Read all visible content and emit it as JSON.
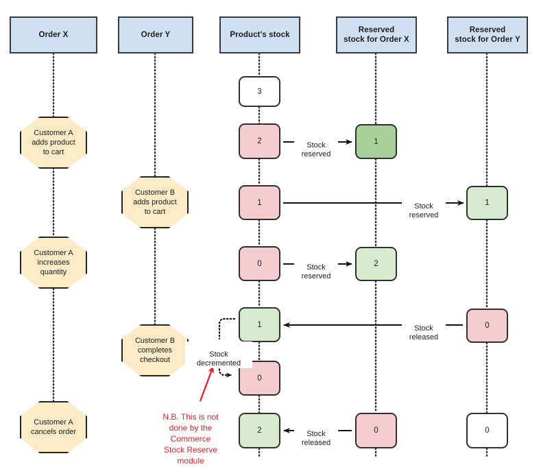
{
  "diagram": {
    "title": "Commerce Stock Reserve sequence diagram",
    "colors": {
      "header_fill": "#cfe0f3",
      "event_fill": "#fdebc8",
      "pink_fill": "#f4cdd1",
      "green_fill": "#d8ead0",
      "green_dark_fill": "#a7d09a",
      "white_fill": "#ffffff",
      "stroke": "#2f2f2f",
      "note_red": "#e8202a"
    },
    "lanes": [
      {
        "id": "order-x",
        "label": "Order X"
      },
      {
        "id": "order-y",
        "label": "Order Y"
      },
      {
        "id": "stock",
        "label": "Product's stock"
      },
      {
        "id": "reserved-x",
        "label": "Reserved\nstock for Order X"
      },
      {
        "id": "reserved-y",
        "label": "Reserved\nstock for Order Y"
      }
    ],
    "events": [
      {
        "id": "customer-a-adds",
        "lane": "order-x",
        "label": "Customer A\nadds product\nto cart"
      },
      {
        "id": "customer-a-increases",
        "lane": "order-x",
        "label": "Customer A\nincreases\nquantity"
      },
      {
        "id": "customer-a-cancels",
        "lane": "order-x",
        "label": "Customer A\ncancels order"
      },
      {
        "id": "customer-b-adds",
        "lane": "order-y",
        "label": "Customer B\nadds product\nto cart"
      },
      {
        "id": "customer-b-checkout",
        "lane": "order-y",
        "label": "Customer B\ncompletes\ncheckout"
      }
    ],
    "states": {
      "stock": [
        {
          "id": "stock-3",
          "value": "3",
          "fill": "white"
        },
        {
          "id": "stock-2",
          "value": "2",
          "fill": "pink"
        },
        {
          "id": "stock-1",
          "value": "1",
          "fill": "pink"
        },
        {
          "id": "stock-0a",
          "value": "0",
          "fill": "pink"
        },
        {
          "id": "stock-1b",
          "value": "1",
          "fill": "green"
        },
        {
          "id": "stock-0b",
          "value": "0",
          "fill": "pink"
        },
        {
          "id": "stock-2b",
          "value": "2",
          "fill": "green"
        }
      ],
      "reserved_x": [
        {
          "id": "resx-1",
          "value": "1",
          "fill": "green-dark"
        },
        {
          "id": "resx-2",
          "value": "2",
          "fill": "green"
        },
        {
          "id": "resx-0",
          "value": "0",
          "fill": "pink"
        }
      ],
      "reserved_y": [
        {
          "id": "resy-1",
          "value": "1",
          "fill": "green"
        },
        {
          "id": "resy-0",
          "value": "0",
          "fill": "pink"
        },
        {
          "id": "resy-0b",
          "value": "0",
          "fill": "white"
        }
      ]
    },
    "edge_labels": [
      {
        "id": "edge-stock-reserved-1",
        "text": "Stock\nreserved"
      },
      {
        "id": "edge-stock-reserved-2",
        "text": "Stock\nreserved"
      },
      {
        "id": "edge-stock-reserved-3",
        "text": "Stock\nreserved"
      },
      {
        "id": "edge-stock-released-1",
        "text": "Stock\nreleased"
      },
      {
        "id": "edge-stock-released-2",
        "text": "Stock\nreleased"
      },
      {
        "id": "edge-stock-decremented",
        "text": "Stock\ndecremented"
      }
    ],
    "note": {
      "id": "nb-note",
      "text": "N.B. This is not\ndone by the\nCommerce\nStock Reserve\nmodule"
    }
  }
}
